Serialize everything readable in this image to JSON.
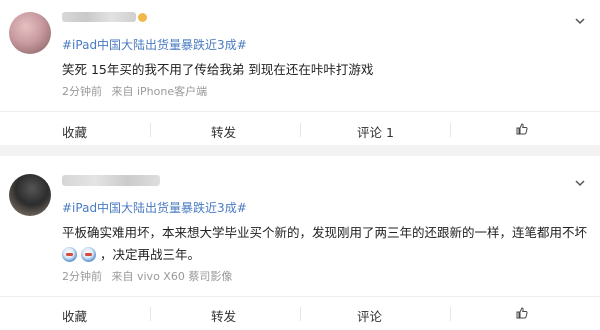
{
  "posts": [
    {
      "topic": "#iPad中国大陆出货量暴跌近3成#",
      "content": "笑死 15年买的我不用了传给我弟 到现在还在咔咔打游戏",
      "meta": {
        "time": "2分钟前",
        "source": "来自 iPhone客户端"
      },
      "actions": {
        "favorite": "收藏",
        "repost": "转发",
        "comment": "评论 1"
      }
    },
    {
      "topic": "#iPad中国大陆出货量暴跌近3成#",
      "content_line1": "平板确实难用坏，本来想大学毕业买个新的，发现刚用了两三年的还跟新的一样，连笔都用不坏",
      "content_line2": "，决定再战三年。",
      "meta": {
        "time": "2分钟前",
        "source": "来自 vivo X60 蔡司影像"
      },
      "actions": {
        "favorite": "收藏",
        "repost": "转发",
        "comment": "评论"
      }
    }
  ],
  "icons": {
    "chevron": "chevron-down-icon",
    "like": "thumbs-up-icon",
    "emoji": "laughing-emoji-icon"
  },
  "colors": {
    "topic": "#4a7bc1",
    "meta": "#999999",
    "background": "#f2f2f2"
  }
}
